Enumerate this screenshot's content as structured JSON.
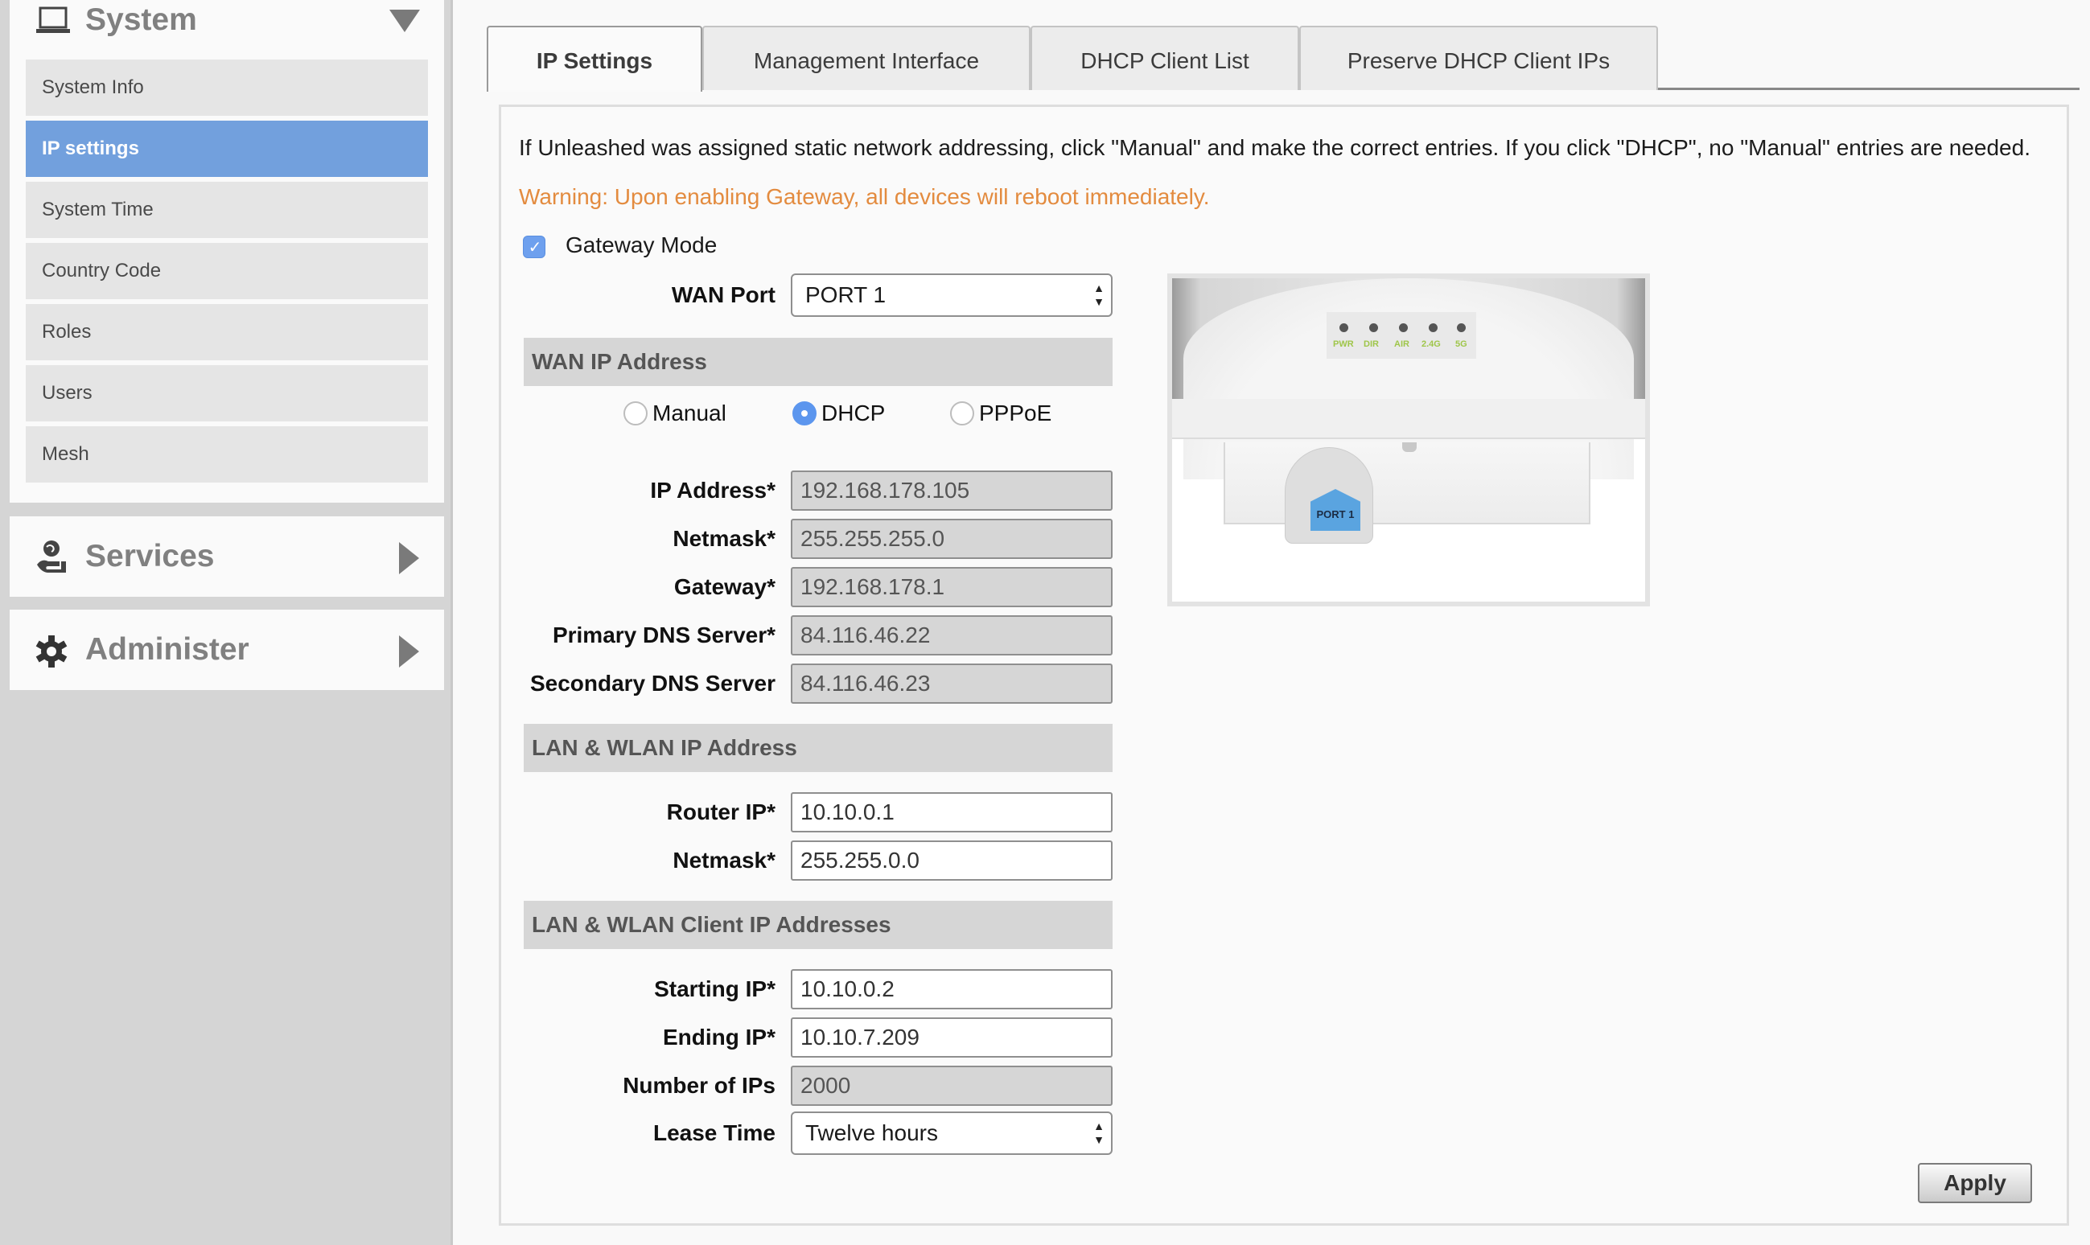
{
  "sidebar": {
    "system": {
      "title": "System",
      "icon": "laptop-icon",
      "expanded": true,
      "items": [
        {
          "label": "System Info",
          "active": false
        },
        {
          "label": "IP settings",
          "active": true
        },
        {
          "label": "System Time",
          "active": false
        },
        {
          "label": "Country Code",
          "active": false
        },
        {
          "label": "Roles",
          "active": false
        },
        {
          "label": "Users",
          "active": false
        },
        {
          "label": "Mesh",
          "active": false
        }
      ]
    },
    "services": {
      "title": "Services",
      "icon": "services-globe-hand-icon",
      "expanded": false
    },
    "administer": {
      "title": "Administer",
      "icon": "gear-icon",
      "expanded": false
    }
  },
  "tabs": [
    {
      "label": "IP Settings",
      "active": true
    },
    {
      "label": "Management Interface",
      "active": false
    },
    {
      "label": "DHCP Client List",
      "active": false
    },
    {
      "label": "Preserve DHCP Client IPs",
      "active": false
    }
  ],
  "content": {
    "intro": "If Unleashed was assigned static network addressing, click \"Manual\" and make the correct entries. If you click \"DHCP\", no \"Manual\" entries are needed.",
    "warning": "Warning: Upon enabling Gateway, all devices will reboot immediately.",
    "warning_color": "#e38b3f",
    "gateway_mode": {
      "label": "Gateway Mode",
      "checked": true
    },
    "wan_port": {
      "label": "WAN Port",
      "value": "PORT 1"
    },
    "wan_section": {
      "title": "WAN IP Address",
      "modes": [
        {
          "label": "Manual",
          "checked": false
        },
        {
          "label": "DHCP",
          "checked": true
        },
        {
          "label": "PPPoE",
          "checked": false
        }
      ],
      "fields": [
        {
          "label": "IP Address*",
          "value": "192.168.178.105",
          "readonly": true
        },
        {
          "label": "Netmask*",
          "value": "255.255.255.0",
          "readonly": true
        },
        {
          "label": "Gateway*",
          "value": "192.168.178.1",
          "readonly": true
        },
        {
          "label": "Primary DNS Server*",
          "value": "84.116.46.22",
          "readonly": true
        },
        {
          "label": "Secondary DNS Server",
          "value": "84.116.46.23",
          "readonly": true
        }
      ]
    },
    "lan_section": {
      "title": "LAN & WLAN IP Address",
      "fields": [
        {
          "label": "Router IP*",
          "value": "10.10.0.1",
          "readonly": false
        },
        {
          "label": "Netmask*",
          "value": "255.255.0.0",
          "readonly": false
        }
      ]
    },
    "client_section": {
      "title": "LAN & WLAN Client IP Addresses",
      "fields": [
        {
          "label": "Starting IP*",
          "value": "10.10.0.2",
          "readonly": false
        },
        {
          "label": "Ending IP*",
          "value": "10.10.7.209",
          "readonly": false
        },
        {
          "label": "Number of IPs",
          "value": "2000",
          "readonly": true
        }
      ],
      "lease_time": {
        "label": "Lease Time",
        "value": "Twelve hours"
      }
    },
    "device_image": {
      "led_labels": [
        "PWR",
        "DIR",
        "AIR",
        "2.4G",
        "5G"
      ],
      "port_tag": "PORT 1"
    },
    "apply_label": "Apply"
  },
  "colors": {
    "active_nav": "#72a0dd",
    "checkbox": "#6ea0ee",
    "sidebar_bg": "#d5d5d5"
  }
}
